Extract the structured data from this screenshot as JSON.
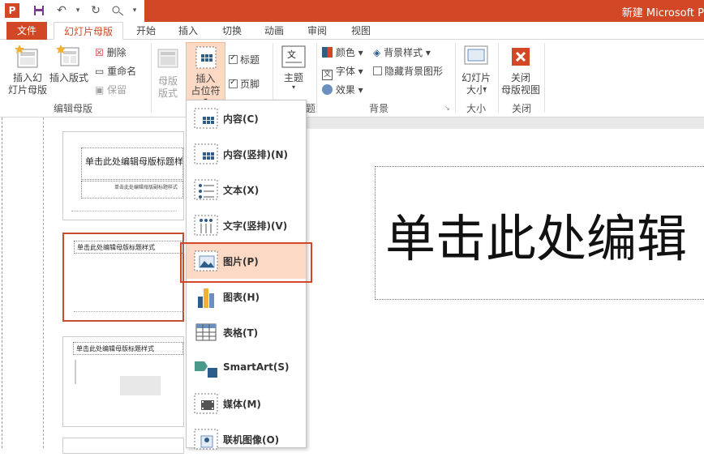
{
  "window": {
    "title": "新建 Microsoft P",
    "app_icon": "powerpoint-icon"
  },
  "tabs": [
    {
      "label": "文件"
    },
    {
      "label": "幻灯片母版"
    },
    {
      "label": "开始"
    },
    {
      "label": "插入"
    },
    {
      "label": "切换"
    },
    {
      "label": "动画"
    },
    {
      "label": "审阅"
    },
    {
      "label": "视图"
    }
  ],
  "ribbon": {
    "edit_master": {
      "insert_slide_master": "插入幻\n灯片母版",
      "insert_layout": "插入版式",
      "delete": "删除",
      "rename": "重命名",
      "preserve": "保留",
      "group": "编辑母版"
    },
    "master_layout": {
      "master_layout": "母版\n版式",
      "insert_placeholder": "插入\n占位符",
      "title_chk": "标题",
      "footer_chk": "页脚"
    },
    "edit_theme": {
      "theme": "主题",
      "group": "题"
    },
    "background": {
      "colors": "颜色",
      "fonts": "字体",
      "effects": "效果",
      "bg_styles": "背景样式",
      "hide_bg": "隐藏背景图形",
      "group": "背景"
    },
    "size": {
      "slide_size": "幻灯片\n大小",
      "group": "大小"
    },
    "close": {
      "close_master": "关闭\n母版视图",
      "group": "关闭"
    }
  },
  "dropdown": {
    "items": [
      {
        "label": "内容(C)",
        "icon": "content-icon"
      },
      {
        "label": "内容(竖排)(N)",
        "icon": "content-vertical-icon"
      },
      {
        "label": "文本(X)",
        "icon": "text-icon"
      },
      {
        "label": "文字(竖排)(V)",
        "icon": "text-vertical-icon"
      },
      {
        "label": "图片(P)",
        "icon": "picture-icon"
      },
      {
        "label": "图表(H)",
        "icon": "chart-icon"
      },
      {
        "label": "表格(T)",
        "icon": "table-icon"
      },
      {
        "label": "SmartArt(S)",
        "icon": "smartart-icon"
      },
      {
        "label": "媒体(M)",
        "icon": "media-icon"
      },
      {
        "label": "联机图像(O)",
        "icon": "online-image-icon"
      }
    ],
    "highlighted_index": 4
  },
  "thumbnails": [
    {
      "title": "单击此处编辑母版标题样式",
      "subtitle": "单击此处编辑母版副标题样式"
    },
    {
      "title": "单击此处编辑母版标题样式"
    },
    {
      "title": "单击此处编辑母版标题样式"
    }
  ],
  "slide": {
    "title_text": "单击此处编辑"
  },
  "colors": {
    "accent": "#d24726",
    "highlight": "#fcd9c5"
  }
}
